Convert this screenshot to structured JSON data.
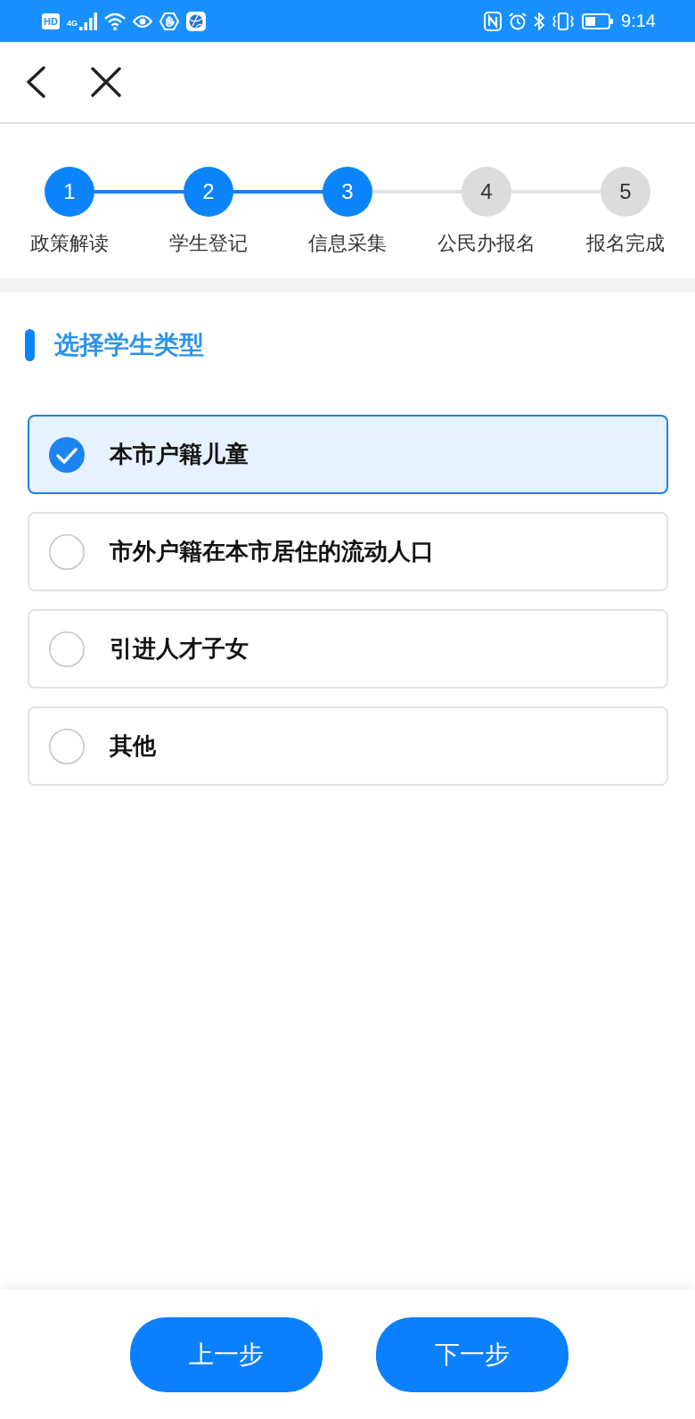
{
  "status_bar": {
    "hd_badge": "HD",
    "network_type": "4G",
    "time": "9:14"
  },
  "stepper": {
    "steps": [
      {
        "number": "1",
        "label": "政策解读",
        "active": true
      },
      {
        "number": "2",
        "label": "学生登记",
        "active": true
      },
      {
        "number": "3",
        "label": "信息采集",
        "active": true
      },
      {
        "number": "4",
        "label": "公民办报名",
        "active": false
      },
      {
        "number": "5",
        "label": "报名完成",
        "active": false
      }
    ]
  },
  "section": {
    "title": "选择学生类型"
  },
  "options": [
    {
      "label": "本市户籍儿童",
      "selected": true
    },
    {
      "label": "市外户籍在本市居住的流动人口",
      "selected": false
    },
    {
      "label": "引进人才子女",
      "selected": false
    },
    {
      "label": "其他",
      "selected": false
    }
  ],
  "buttons": [
    "上一步",
    "下一步"
  ]
}
